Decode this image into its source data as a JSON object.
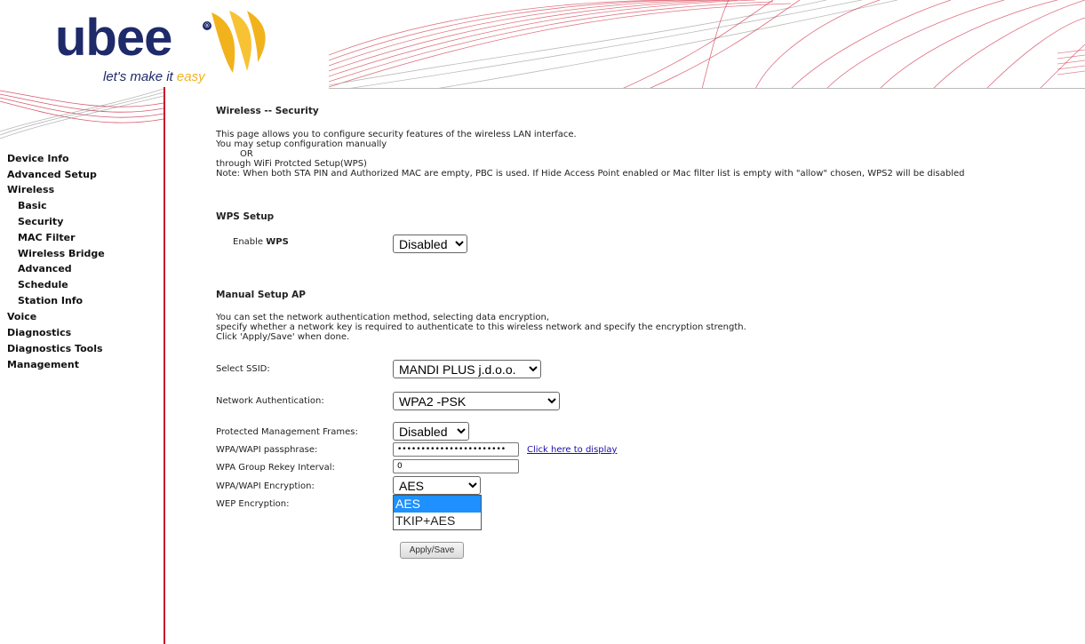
{
  "header": {
    "logo": "ubee",
    "tagline_main": "let's make it ",
    "tagline_accent": "easy"
  },
  "sidebar": {
    "items": [
      {
        "label": "Device Info"
      },
      {
        "label": "Advanced Setup"
      },
      {
        "label": "Wireless"
      },
      {
        "label": "Basic"
      },
      {
        "label": "Security"
      },
      {
        "label": "MAC Filter"
      },
      {
        "label": "Wireless Bridge"
      },
      {
        "label": "Advanced"
      },
      {
        "label": "Schedule"
      },
      {
        "label": "Station Info"
      },
      {
        "label": "Voice"
      },
      {
        "label": "Diagnostics"
      },
      {
        "label": "Diagnostics Tools"
      },
      {
        "label": "Management"
      }
    ]
  },
  "main": {
    "title": "Wireless -- Security",
    "intro": [
      "This page allows you to configure security features of the wireless LAN interface.",
      "You may setup configuration manually",
      "OR",
      "through WiFi Protcted Setup(WPS)",
      "Note: When both STA PIN and Authorized MAC are empty, PBC is used. If Hide Access Point enabled or Mac filter list is empty with \"allow\" chosen, WPS2 will be disabled"
    ],
    "wps": {
      "heading": "WPS Setup",
      "enable_label_prefix": "Enable ",
      "enable_label_bold": "WPS",
      "value": "Disabled"
    },
    "manual": {
      "heading": "Manual Setup AP",
      "desc": [
        "You can set the network authentication method, selecting data encryption,",
        "specify whether a network key is required to authenticate to this wireless network and specify the encryption strength.",
        "Click 'Apply/Save' when done."
      ],
      "ssid_label": "Select SSID:",
      "ssid_value": "MANDI PLUS j.d.o.o.",
      "auth_label": "Network Authentication:",
      "auth_value": "WPA2 -PSK",
      "pmf_label": "Protected Management Frames:",
      "pmf_value": "Disabled",
      "passphrase_label": "WPA/WAPI passphrase:",
      "passphrase_value": "•••••••••••••••••••••••",
      "display_link": "Click here to display",
      "rekey_label": "WPA Group Rekey Interval:",
      "rekey_value": "0",
      "encryption_label": "WPA/WAPI Encryption:",
      "encryption_value": "AES",
      "encryption_options": [
        "AES",
        "TKIP+AES"
      ],
      "wep_label": "WEP Encryption:",
      "apply_label": "Apply/Save"
    }
  },
  "colors": {
    "brand_navy": "#1e2a6a",
    "brand_yellow": "#f2b21c",
    "accent_red": "#c8102e",
    "selection_blue": "#1e90ff"
  }
}
